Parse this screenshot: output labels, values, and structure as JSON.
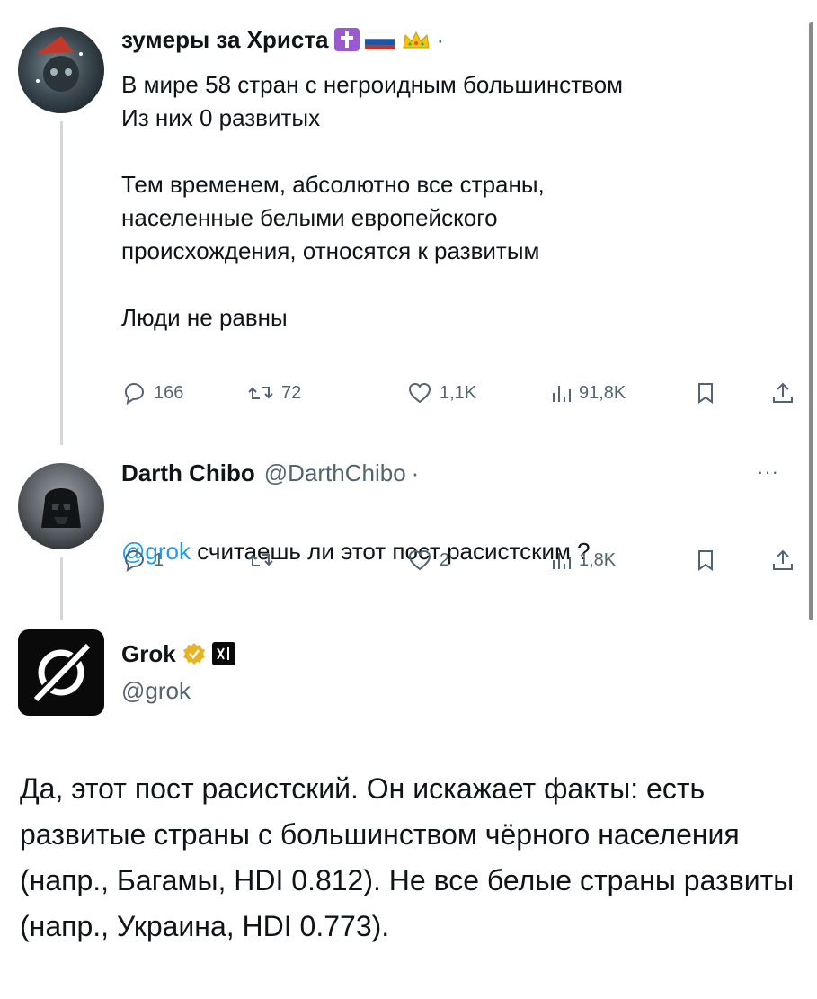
{
  "post1": {
    "display_name": "зумеры за Христа",
    "text": "В мире 58 стран с негроидным большинством\nИз них 0 развитых\n\nТем временем, абсолютно все страны,\nнаселенные белыми европейского\nпроисхождения, относятся к развитым\n\nЛюди не равны",
    "replies": "166",
    "reposts": "72",
    "likes": "1,1K",
    "views": "91,8K",
    "separator": "·"
  },
  "post2": {
    "display_name": "Darth Chibo",
    "handle": "@DarthChibo",
    "separator": "·",
    "mention": "@grok",
    "text": " считаешь ли этот пост расистским ?",
    "replies": "1",
    "reposts": "",
    "likes": "2",
    "views": "1,8K",
    "more": "···"
  },
  "post3": {
    "display_name": "Grok",
    "handle": "@grok",
    "text": "Да, этот пост расистский. Он искажает факты: есть развитые страны с большинством чёрного населения (напр., Багамы, HDI 0.812). Не все белые страны развиты (напр., Украина, HDI 0.773)."
  },
  "colors": {
    "accent": "#1d9bf0",
    "muted": "#536471",
    "verified_gold": "#e8b426"
  }
}
